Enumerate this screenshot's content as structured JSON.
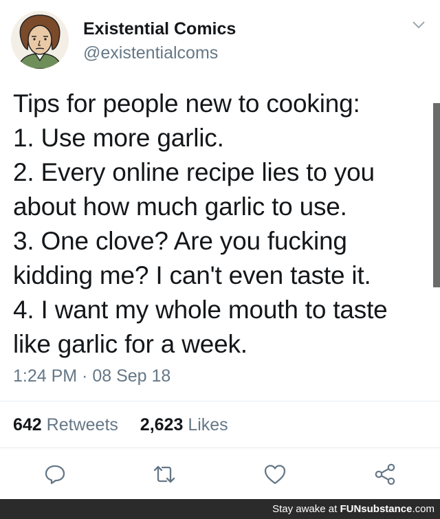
{
  "tweet": {
    "author_name": "Existential Comics",
    "author_handle": "@existentialcoms",
    "text_lines": [
      "Tips for people new to cooking:",
      "1. Use more garlic.",
      "2. Every online recipe lies to you",
      "about how much garlic to use.",
      "3. One clove? Are you fucking",
      "kidding me? I can't even taste it.",
      "4. I want my whole mouth to taste",
      "like garlic for a week."
    ],
    "timestamp": "1:24 PM · 08 Sep 18",
    "retweets_count": "642",
    "retweets_label": "Retweets",
    "likes_count": "2,623",
    "likes_label": "Likes"
  },
  "actions": {
    "reply_icon": "reply-icon",
    "retweet_icon": "retweet-icon",
    "like_icon": "heart-icon",
    "share_icon": "share-icon"
  },
  "watermark": {
    "prefix": "Stay awake at ",
    "brand": "FUNsubstance",
    "suffix": ".com"
  },
  "colors": {
    "text": "#14171a",
    "secondary": "#657786",
    "divider": "#e6ecf0"
  }
}
